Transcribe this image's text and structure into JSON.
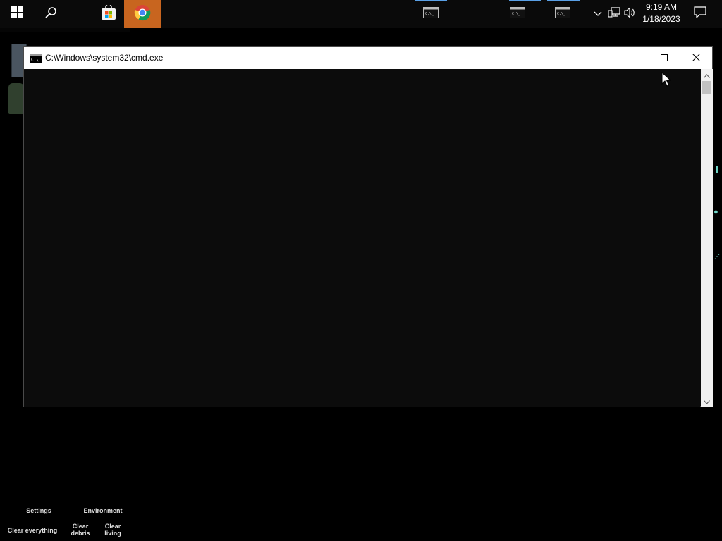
{
  "taskbar": {
    "pinned": [
      {
        "name": "start",
        "icon": "windows-logo-icon"
      },
      {
        "name": "search",
        "icon": "search-icon"
      },
      {
        "name": "store",
        "icon": "microsoft-store-icon"
      },
      {
        "name": "chrome",
        "icon": "chrome-icon"
      }
    ],
    "windows": [
      "cmd-1",
      "cmd-2",
      "cmd-3"
    ],
    "clock": {
      "time": "9:19 AM",
      "date": "1/18/2023"
    },
    "colors": {
      "accent": "#5aa0e6",
      "chrome_bg": "#c8651f"
    }
  },
  "cmd_window": {
    "title": "C:\\Windows\\system32\\cmd.exe",
    "icon_text": "C:\\",
    "controls": [
      "minimize",
      "maximize",
      "close"
    ]
  },
  "bottom_panel": {
    "settings": "Settings",
    "environment": "Environment",
    "clear_everything": "Clear everything",
    "clear_debris": "Clear debris",
    "clear_living": "Clear living"
  }
}
